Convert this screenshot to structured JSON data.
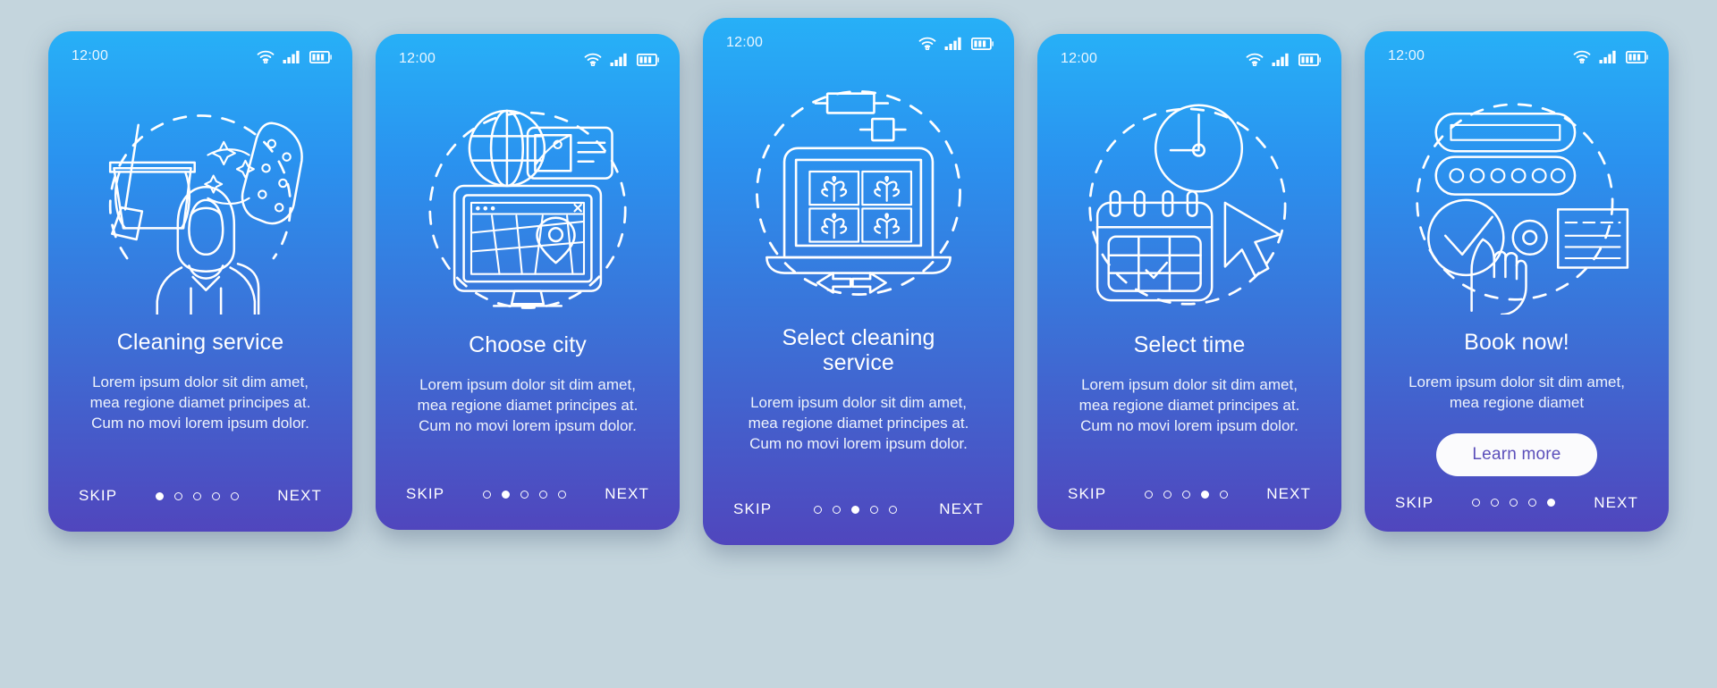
{
  "background_color": "#c4d5dd",
  "theme": {
    "gradient_top": "#27b0f7",
    "gradient_bottom": "#5046bd",
    "text_color": "#ffffff",
    "cta_bg": "#fbfbfd",
    "cta_text": "#5b4fba"
  },
  "common": {
    "clock": "12:00",
    "skip_label": "SKIP",
    "next_label": "NEXT",
    "description": "Lorem ipsum dolor sit dim amet, mea regione diamet principes at. Cum no movi lorem ipsum dolor.",
    "dot_count": 5,
    "status_icons": [
      "wifi-icon",
      "cellular-signal-icon",
      "battery-icon"
    ]
  },
  "screens": [
    {
      "id": "cleaning-service",
      "clock": "12:00",
      "title": "Cleaning service",
      "description": "Lorem ipsum dolor sit dim amet, mea regione diamet principes at. Cum no movi lorem ipsum dolor.",
      "skip_label": "SKIP",
      "next_label": "NEXT",
      "active_dot": 1,
      "illustration": "cleaning-maid-bucket-broom-sponge-illustration"
    },
    {
      "id": "choose-city",
      "clock": "12:00",
      "title": "Choose city",
      "description": "Lorem ipsum dolor sit dim amet, mea regione diamet principes at. Cum no movi lorem ipsum dolor.",
      "skip_label": "SKIP",
      "next_label": "NEXT",
      "active_dot": 2,
      "illustration": "globe-map-monitor-location-illustration"
    },
    {
      "id": "select-cleaning-service",
      "clock": "12:00",
      "title": "Select cleaning service",
      "description": "Lorem ipsum dolor sit dim amet, mea regione diamet principes at. Cum no movi lorem ipsum dolor.",
      "skip_label": "SKIP",
      "next_label": "NEXT",
      "active_dot": 3,
      "illustration": "laptop-gallery-arrows-illustration"
    },
    {
      "id": "select-time",
      "clock": "12:00",
      "title": "Select time",
      "description": "Lorem ipsum dolor sit dim amet, mea regione diamet principes at. Cum no movi lorem ipsum dolor.",
      "skip_label": "SKIP",
      "next_label": "NEXT",
      "active_dot": 4,
      "illustration": "clock-calendar-cursor-illustration"
    },
    {
      "id": "book-now",
      "clock": "12:00",
      "title": "Book now!",
      "description": "Lorem ipsum dolor sit dim amet, mea regione diamet",
      "cta_label": "Learn more",
      "skip_label": "SKIP",
      "next_label": "NEXT",
      "active_dot": 5,
      "illustration": "form-checkmark-hand-pointer-illustration"
    }
  ]
}
